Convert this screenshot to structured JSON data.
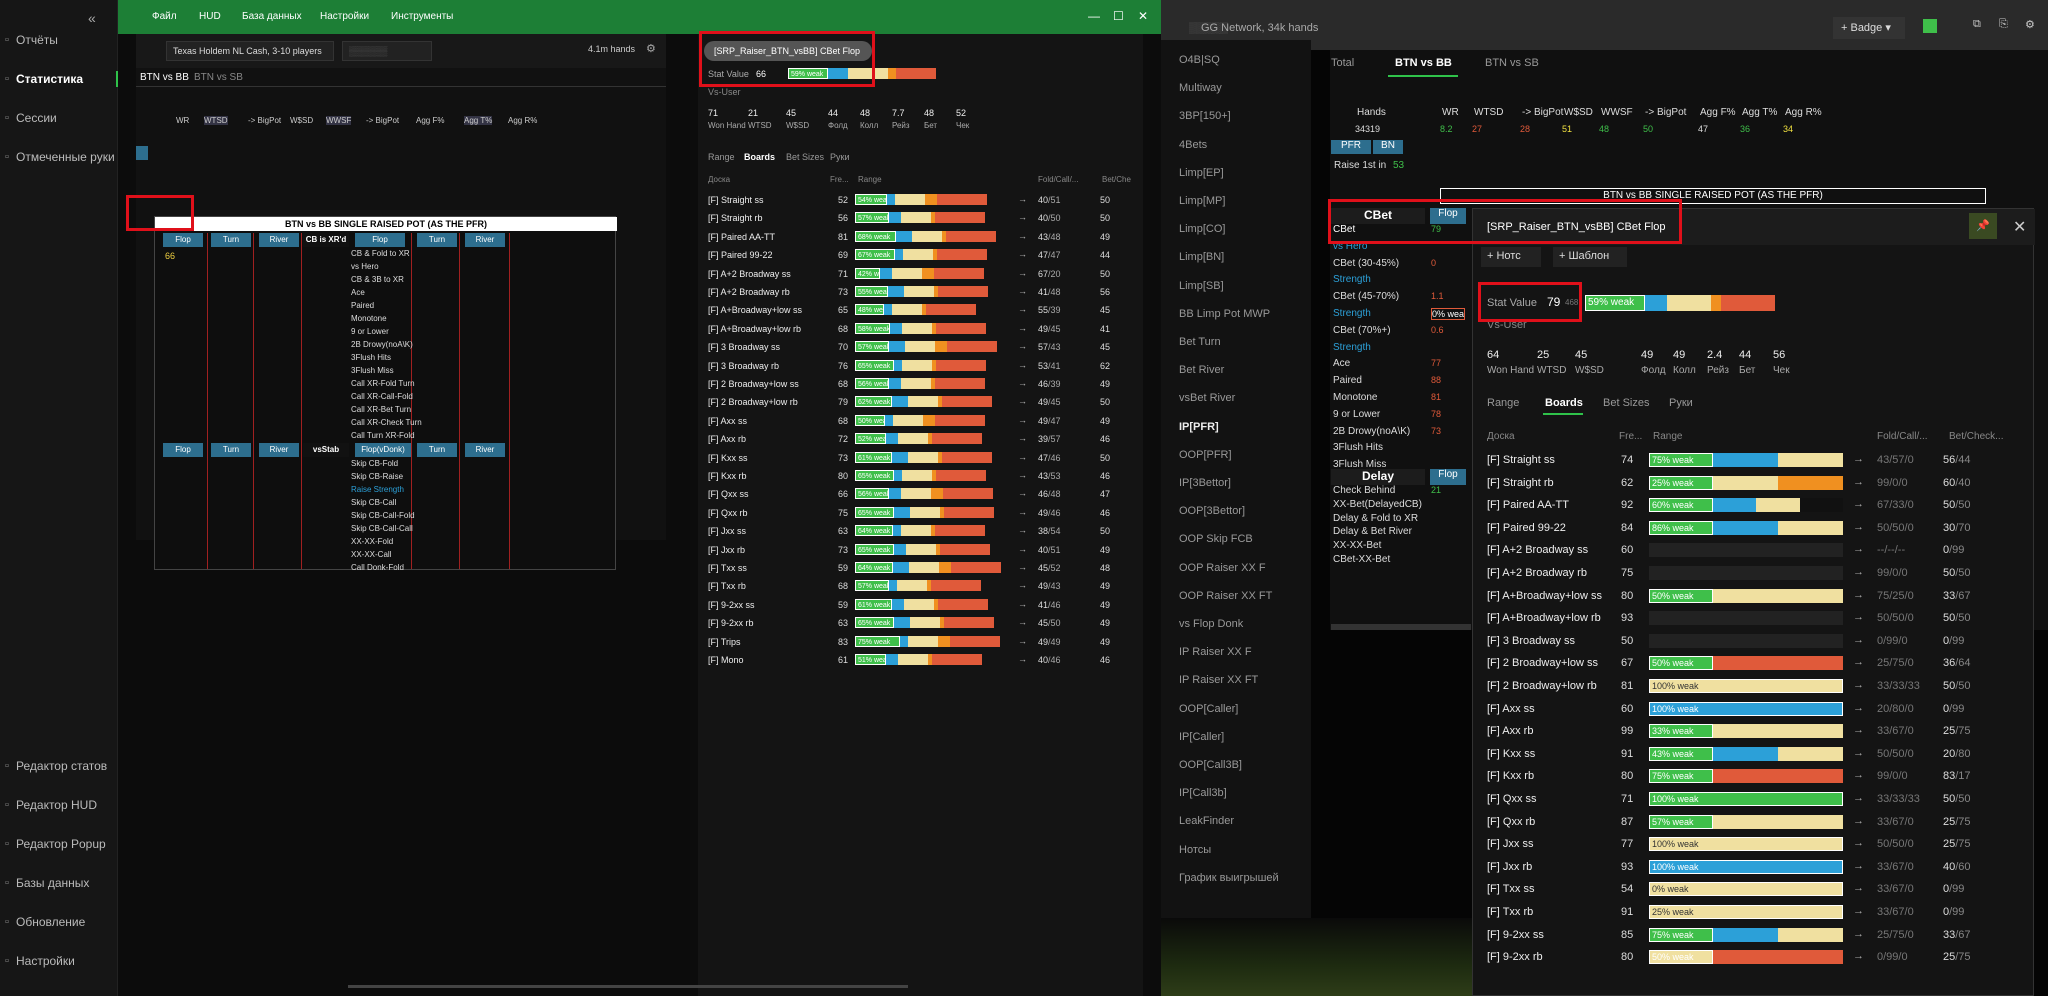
{
  "sidebar": {
    "items": [
      {
        "label": "Отчёты",
        "icon": "report-icon"
      },
      {
        "label": "Статистика",
        "icon": "stats-icon",
        "active": true
      },
      {
        "label": "Сессии",
        "icon": "sessions-icon"
      },
      {
        "label": "Отмеченные руки",
        "icon": "marked-icon"
      },
      {
        "label": "Редактор статов",
        "icon": "editor-icon"
      },
      {
        "label": "Редактор HUD",
        "icon": "hud-icon"
      },
      {
        "label": "Редактор Popup",
        "icon": "popup-icon"
      },
      {
        "label": "Базы данных",
        "icon": "db-icon"
      },
      {
        "label": "Обновление",
        "icon": "update-icon"
      },
      {
        "label": "Настройки",
        "icon": "settings-icon"
      }
    ]
  },
  "left": {
    "menu": [
      "Файл",
      "HUD",
      "База данных",
      "Настройки",
      "Инструменты"
    ],
    "filter": {
      "game": "Texas Holdem NL Cash, 3-10 players",
      "hands": "4.1m hands"
    },
    "tabs": [
      "BTN vs BB",
      "BTN vs SB"
    ],
    "stats_headers": [
      "WR",
      "WTSD",
      "-> BigPot",
      "W$SD",
      "WWSF",
      "-> BigPot",
      "Agg F%",
      "Agg T%",
      "Agg R%"
    ],
    "grid_title": "BTN vs BB SINGLE RAISED POT (AS THE PFR)",
    "grid_cols": [
      "Flop",
      "Turn",
      "River",
      "CB is XR'd",
      "Flop",
      "Turn",
      "River"
    ],
    "grid_cols2": [
      "Flop",
      "Turn",
      "River",
      "vsStab",
      "Flop(vDonk)",
      "Turn",
      "River"
    ],
    "grid_rows": [
      "CB & Fold to XR",
      "vs Hero",
      "CB & 3B to XR",
      "Ace",
      "Paired",
      "Monotone",
      "9 or Lower",
      "2B Drowy(noA\\K)",
      "3Flush Hits",
      "3Flush Miss",
      "Call XR-Fold Turn",
      "Call XR-Call-Fold",
      "Call XR-Bet Turn",
      "Call XR-Check Turn",
      "Call Turn XR-Fold"
    ],
    "grid_rows2": [
      "Skip CB-Fold",
      "Skip CB-Raise",
      "Raise Strength",
      "Skip CB-Call",
      "Skip CB-Call-Fold",
      "Skip CB-Call-Call",
      "XX-XX-Fold",
      "XX-XX-Call",
      "Call Donk-Fold"
    ],
    "flop_val": "66",
    "popup": {
      "title": "[SRP_Raiser_BTN_vsBB] CBet Flop",
      "stat_label": "Stat Value",
      "stat_value": "66",
      "stat_weak": "59% weak",
      "vs_user": "Vs-User",
      "mini": [
        {
          "v": "71",
          "l": "Won Hand"
        },
        {
          "v": "21",
          "l": "WTSD"
        },
        {
          "v": "45",
          "l": "W$SD"
        },
        {
          "v": "44",
          "l": "Фолд"
        },
        {
          "v": "48",
          "l": "Колл"
        },
        {
          "v": "7.7",
          "l": "Рейз"
        },
        {
          "v": "48",
          "l": "Бет"
        },
        {
          "v": "52",
          "l": "Чек"
        }
      ],
      "tabs": [
        "Range",
        "Boards",
        "Bet Sizes",
        "Руки"
      ],
      "cols": [
        "Доска",
        "Fre...",
        "Range",
        "Fold/Call/...",
        "Bet/Che"
      ],
      "rows": [
        {
          "n": "[F] Straight ss",
          "f": "52",
          "w": "54% weak",
          "a": "40",
          "b": "/51",
          "c": "50"
        },
        {
          "n": "[F] Straight rb",
          "f": "56",
          "w": "57% weak",
          "a": "40",
          "b": "/50",
          "c": "50"
        },
        {
          "n": "[F] Paired AA-TT",
          "f": "81",
          "w": "68% weak",
          "a": "43",
          "b": "/48",
          "c": "49"
        },
        {
          "n": "[F] Paired 99-22",
          "f": "69",
          "w": "67% weak",
          "a": "47",
          "b": "/47",
          "c": "44"
        },
        {
          "n": "[F] A+2 Broadway ss",
          "f": "71",
          "w": "42% weak",
          "a": "67",
          "b": "/20",
          "c": "50"
        },
        {
          "n": "[F] A+2 Broadway rb",
          "f": "73",
          "w": "55% weak",
          "a": "41",
          "b": "/48",
          "c": "56"
        },
        {
          "n": "[F] A+Broadway+low ss",
          "f": "65",
          "w": "48% weak",
          "a": "55",
          "b": "/39",
          "c": "45"
        },
        {
          "n": "[F] A+Broadway+low rb",
          "f": "68",
          "w": "58% weak",
          "a": "49",
          "b": "/45",
          "c": "41"
        },
        {
          "n": "[F] 3 Broadway ss",
          "f": "70",
          "w": "57% weak",
          "a": "57",
          "b": "/43",
          "c": "45"
        },
        {
          "n": "[F] 3 Broadway rb",
          "f": "76",
          "w": "65% weak",
          "a": "53",
          "b": "/41",
          "c": "62"
        },
        {
          "n": "[F] 2 Broadway+low ss",
          "f": "68",
          "w": "56% weak",
          "a": "46",
          "b": "/39",
          "c": "49"
        },
        {
          "n": "[F] 2 Broadway+low rb",
          "f": "79",
          "w": "62% weak",
          "a": "49",
          "b": "/45",
          "c": "50"
        },
        {
          "n": "[F] Axx ss",
          "f": "68",
          "w": "50% weak",
          "a": "49",
          "b": "/47",
          "c": "49"
        },
        {
          "n": "[F] Axx rb",
          "f": "72",
          "w": "52% weak",
          "a": "39",
          "b": "/57",
          "c": "46"
        },
        {
          "n": "[F] Kxx ss",
          "f": "73",
          "w": "61% weak",
          "a": "47",
          "b": "/46",
          "c": "50"
        },
        {
          "n": "[F] Kxx rb",
          "f": "80",
          "w": "65% weak",
          "a": "43",
          "b": "/53",
          "c": "46"
        },
        {
          "n": "[F] Qxx ss",
          "f": "66",
          "w": "56% weak",
          "a": "46",
          "b": "/48",
          "c": "47"
        },
        {
          "n": "[F] Qxx rb",
          "f": "75",
          "w": "65% weak",
          "a": "49",
          "b": "/46",
          "c": "46"
        },
        {
          "n": "[F] Jxx ss",
          "f": "63",
          "w": "64% weak",
          "a": "38",
          "b": "/54",
          "c": "50"
        },
        {
          "n": "[F] Jxx rb",
          "f": "73",
          "w": "65% weak",
          "a": "40",
          "b": "/51",
          "c": "49"
        },
        {
          "n": "[F] Txx ss",
          "f": "59",
          "w": "64% weak",
          "a": "45",
          "b": "/52",
          "c": "48"
        },
        {
          "n": "[F] Txx rb",
          "f": "68",
          "w": "57% weak",
          "a": "49",
          "b": "/43",
          "c": "49"
        },
        {
          "n": "[F] 9-2xx ss",
          "f": "59",
          "w": "61% weak",
          "a": "41",
          "b": "/46",
          "c": "49"
        },
        {
          "n": "[F] 9-2xx rb",
          "f": "63",
          "w": "65% weak",
          "a": "45",
          "b": "/50",
          "c": "49"
        },
        {
          "n": "[F] Trips",
          "f": "83",
          "w": "75% weak",
          "a": "49",
          "b": "/49",
          "c": "49"
        },
        {
          "n": "[F] Mono",
          "f": "61",
          "w": "51% weak",
          "a": "40",
          "b": "/46",
          "c": "46"
        }
      ]
    }
  },
  "right": {
    "title": "GG Network, 34k hands",
    "badge": "+ Badge",
    "nav": [
      "O4B|SQ",
      "Multiway",
      "3BP[150+]",
      "4Bets",
      "Limp[EP]",
      "Limp[MP]",
      "Limp[CO]",
      "Limp[BN]",
      "Limp[SB]",
      "BB Limp Pot MWP",
      "Bet Turn",
      "Bet River",
      "vsBet River",
      "IP[PFR]",
      "OOP[PFR]",
      "IP[3Bettor]",
      "OOP[3Bettor]",
      "OOP Skip FCB",
      "OOP Raiser XX F",
      "OOP Raiser XX FT",
      "vs Flop Donk",
      "IP Raiser XX F",
      "IP Raiser XX FT",
      "OOP[Caller]",
      "IP[Caller]",
      "OOP[Call3B]",
      "IP[Call3b]",
      "LeakFinder",
      "Нотсы",
      "График выигрышей"
    ],
    "tabs": [
      "Total",
      "BTN vs BB",
      "BTN vs SB"
    ],
    "stat_heads": [
      "Hands",
      "WR",
      "WTSD",
      "-> BigPot",
      "W$SD",
      "WWSF",
      "-> BigPot",
      "Agg F%",
      "Agg T%",
      "Agg R%"
    ],
    "stat_vals": [
      "34319",
      "8.2",
      "27",
      "28",
      "51",
      "48",
      "50",
      "47",
      "36",
      "34"
    ],
    "pfr": "PFR",
    "bn": "BN",
    "raise1st": "Raise 1st in",
    "raise1st_val": "53",
    "grid_title": "BTN vs BB SINGLE RAISED POT (AS THE PFR)",
    "cbet_head": "CBet",
    "flop_head": "Flop",
    "rows": [
      "CBet",
      "vs Hero",
      "CBet (30-45%)",
      "Strength",
      "CBet (45-70%)",
      "Strength",
      "CBet (70%+)",
      "Strength",
      "Ace",
      "Paired",
      "Monotone",
      "9 or Lower",
      "2B Drowy(noA\\K)",
      "3Flush Hits",
      "3Flush Miss"
    ],
    "row_vals": [
      "79",
      "",
      "0",
      "",
      "1.1",
      "0% wea",
      "0.6",
      "",
      "77",
      "88",
      "81",
      "78",
      "73",
      "",
      ""
    ],
    "delay_head": "Delay",
    "delay_rows": [
      "Check Behind",
      "XX-Bet(DelayedCB)",
      "Delay & Fold to XR",
      "Delay & Bet River",
      "XX-XX-Bet",
      "CBet-XX-Bet"
    ],
    "delay_val": "21",
    "popup": {
      "title": "[SRP_Raiser_BTN_vsBB] CBet Flop",
      "notes": "+ Нотс",
      "template": "+ Шаблон",
      "stat_label": "Stat Value",
      "stat_value": "79",
      "stat_sub": "468",
      "stat_weak": "59% weak",
      "vs_user": "Vs-User",
      "mini": [
        {
          "v": "64",
          "l": "Won Hand"
        },
        {
          "v": "25",
          "l": "WTSD"
        },
        {
          "v": "45",
          "l": "W$SD"
        },
        {
          "v": "49",
          "l": "Фолд"
        },
        {
          "v": "49",
          "l": "Колл"
        },
        {
          "v": "2.4",
          "l": "Рейз"
        },
        {
          "v": "44",
          "l": "Бет"
        },
        {
          "v": "56",
          "l": "Чек"
        }
      ],
      "tabs": [
        "Range",
        "Boards",
        "Bet Sizes",
        "Руки"
      ],
      "cols": [
        "Доска",
        "Fre...",
        "Range",
        "Fold/Call/...",
        "Bet/Check..."
      ],
      "rows": [
        {
          "n": "[F] Straight ss",
          "f": "74",
          "w": "75% weak",
          "a": "43",
          "b": "/57",
          "c": "/0",
          "d": "56",
          "e": "/44",
          "t": "gby"
        },
        {
          "n": "[F] Straight rb",
          "f": "62",
          "w": "25% weak",
          "a": "99",
          "b": "/0",
          "c": "/0",
          "d": "60",
          "e": "/40",
          "t": "gyo"
        },
        {
          "n": "[F] Paired AA-TT",
          "f": "92",
          "w": "60% weak",
          "a": "67",
          "b": "/33",
          "c": "/0",
          "d": "50",
          "e": "/50",
          "t": "gbyk"
        },
        {
          "n": "[F] Paired 99-22",
          "f": "84",
          "w": "86% weak",
          "a": "50",
          "b": "/50",
          "c": "/0",
          "d": "30",
          "e": "/70",
          "t": "gby"
        },
        {
          "n": "[F] A+2 Broadway ss",
          "f": "60",
          "w": "",
          "a": "--",
          "b": "/--",
          "c": "/--",
          "d": "0",
          "e": "/99",
          "t": ""
        },
        {
          "n": "[F] A+2 Broadway rb",
          "f": "75",
          "w": "",
          "a": "99",
          "b": "/0",
          "c": "/0",
          "d": "50",
          "e": "/50",
          "t": ""
        },
        {
          "n": "[F] A+Broadway+low ss",
          "f": "80",
          "w": "50% weak",
          "a": "75",
          "b": "/25",
          "c": "/0",
          "d": "33",
          "e": "/67",
          "t": "gy"
        },
        {
          "n": "[F] A+Broadway+low rb",
          "f": "93",
          "w": "",
          "a": "50",
          "b": "/50",
          "c": "/0",
          "d": "50",
          "e": "/50",
          "t": ""
        },
        {
          "n": "[F] 3 Broadway ss",
          "f": "50",
          "w": "",
          "a": "0",
          "b": "/99",
          "c": "/0",
          "d": "0",
          "e": "/99",
          "t": ""
        },
        {
          "n": "[F] 2 Broadway+low ss",
          "f": "67",
          "w": "50% weak",
          "a": "25",
          "b": "/75",
          "c": "/0",
          "d": "36",
          "e": "/64",
          "t": "gr"
        },
        {
          "n": "[F] 2 Broadway+low rb",
          "f": "81",
          "w": "100% weak",
          "a": "33",
          "b": "/33",
          "c": "/33",
          "d": "50",
          "e": "/50",
          "t": "y"
        },
        {
          "n": "[F] Axx ss",
          "f": "60",
          "w": "100% weak",
          "a": "20",
          "b": "/80",
          "c": "/0",
          "d": "0",
          "e": "/99",
          "t": "b"
        },
        {
          "n": "[F] Axx rb",
          "f": "99",
          "w": "33% weak",
          "a": "33",
          "b": "/67",
          "c": "/0",
          "d": "25",
          "e": "/75",
          "t": "gy"
        },
        {
          "n": "[F] Kxx ss",
          "f": "91",
          "w": "43% weak",
          "a": "50",
          "b": "/50",
          "c": "/0",
          "d": "20",
          "e": "/80",
          "t": "gby"
        },
        {
          "n": "[F] Kxx rb",
          "f": "80",
          "w": "75% weak",
          "a": "99",
          "b": "/0",
          "c": "/0",
          "d": "83",
          "e": "/17",
          "t": "gr"
        },
        {
          "n": "[F] Qxx ss",
          "f": "71",
          "w": "100% weak",
          "a": "33",
          "b": "/33",
          "c": "/33",
          "d": "50",
          "e": "/50",
          "t": "g"
        },
        {
          "n": "[F] Qxx rb",
          "f": "87",
          "w": "57% weak",
          "a": "33",
          "b": "/67",
          "c": "/0",
          "d": "25",
          "e": "/75",
          "t": "gy"
        },
        {
          "n": "[F] Jxx ss",
          "f": "77",
          "w": "100% weak",
          "a": "50",
          "b": "/50",
          "c": "/0",
          "d": "25",
          "e": "/75",
          "t": "y"
        },
        {
          "n": "[F] Jxx rb",
          "f": "93",
          "w": "100% weak",
          "a": "33",
          "b": "/67",
          "c": "/0",
          "d": "40",
          "e": "/60",
          "t": "b"
        },
        {
          "n": "[F] Txx ss",
          "f": "54",
          "w": "0% weak",
          "a": "33",
          "b": "/67",
          "c": "/0",
          "d": "0",
          "e": "/99",
          "t": "y"
        },
        {
          "n": "[F] Txx rb",
          "f": "91",
          "w": "25% weak",
          "a": "33",
          "b": "/67",
          "c": "/0",
          "d": "0",
          "e": "/99",
          "t": "y"
        },
        {
          "n": "[F] 9-2xx ss",
          "f": "85",
          "w": "75% weak",
          "a": "25",
          "b": "/75",
          "c": "/0",
          "d": "33",
          "e": "/67",
          "t": "gby"
        },
        {
          "n": "[F] 9-2xx rb",
          "f": "80",
          "w": "50% weak",
          "a": "0",
          "b": "/99",
          "c": "/0",
          "d": "25",
          "e": "/75",
          "t": "yr"
        }
      ]
    }
  }
}
